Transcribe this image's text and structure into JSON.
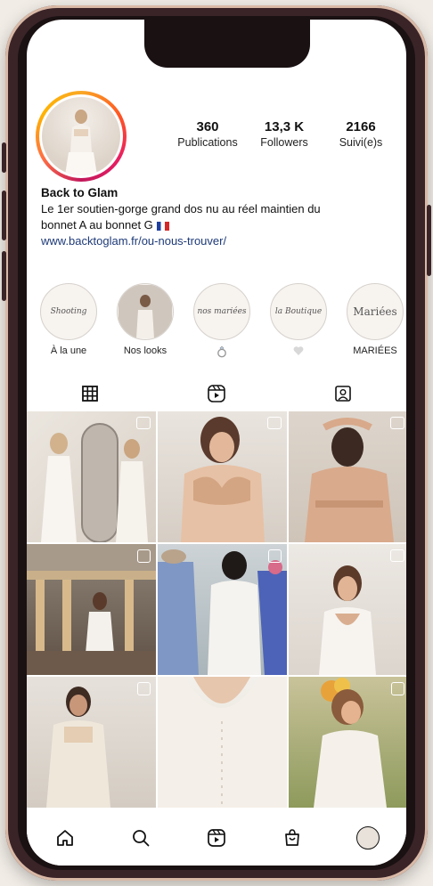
{
  "profile": {
    "name": "Back to Glam",
    "bio_line1": "Le 1er soutien-gorge grand dos nu au réel maintien du",
    "bio_line2": "bonnet A au bonnet G",
    "link": "www.backtoglam.fr/ou-nous-trouver/"
  },
  "stats": [
    {
      "value": "360",
      "label": "Publications"
    },
    {
      "value": "13,3 K",
      "label": "Followers"
    },
    {
      "value": "2166",
      "label": "Suivi(e)s"
    }
  ],
  "highlights": [
    {
      "cover": "Shooting",
      "label": "À la une"
    },
    {
      "cover": "",
      "label": "Nos looks"
    },
    {
      "cover": "nos mariées",
      "label": ""
    },
    {
      "cover": "la Boutique",
      "label": ""
    },
    {
      "cover": "Mariées",
      "label": "MARIÉES"
    }
  ],
  "tabs": [
    {
      "icon": "grid-icon",
      "active": true
    },
    {
      "icon": "reels-icon",
      "active": false
    },
    {
      "icon": "tagged-icon",
      "active": false
    }
  ],
  "bottom_nav": [
    "home-icon",
    "search-icon",
    "reels-icon",
    "shop-icon",
    "profile-avatar"
  ],
  "colors": {
    "link": "#1e3a78",
    "ring_gradient": [
      "#f9a825",
      "#e91e63"
    ],
    "phone_frame": "#3a2428"
  }
}
